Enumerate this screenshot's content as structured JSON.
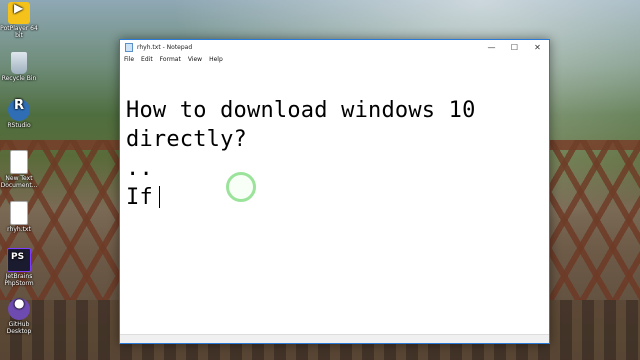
{
  "desktop": {
    "icons": [
      {
        "label": "PotPlayer 64 bit",
        "icon": "potplayer-icon"
      },
      {
        "label": "Recycle Bin",
        "icon": "recycle-bin-icon"
      },
      {
        "label": "RStudio",
        "icon": "rstudio-icon"
      },
      {
        "label": "New Text Document...",
        "icon": "text-document-icon"
      },
      {
        "label": "rhyh.txt",
        "icon": "text-document-icon"
      },
      {
        "label": "JetBrains PhpStorm",
        "icon": "phpstorm-icon"
      },
      {
        "label": "GitHub Desktop",
        "icon": "github-desktop-icon"
      }
    ]
  },
  "window": {
    "title": "rhyh.txt - Notepad",
    "controls": {
      "minimize": "—",
      "maximize": "☐",
      "close": "✕"
    },
    "menu": [
      "File",
      "Edit",
      "Format",
      "View",
      "Help"
    ],
    "content_lines": [
      "How to download windows 10",
      "directly?",
      "..",
      "If"
    ]
  },
  "colors": {
    "window_border": "#2b79d6",
    "click_ring": "#9be39b"
  }
}
